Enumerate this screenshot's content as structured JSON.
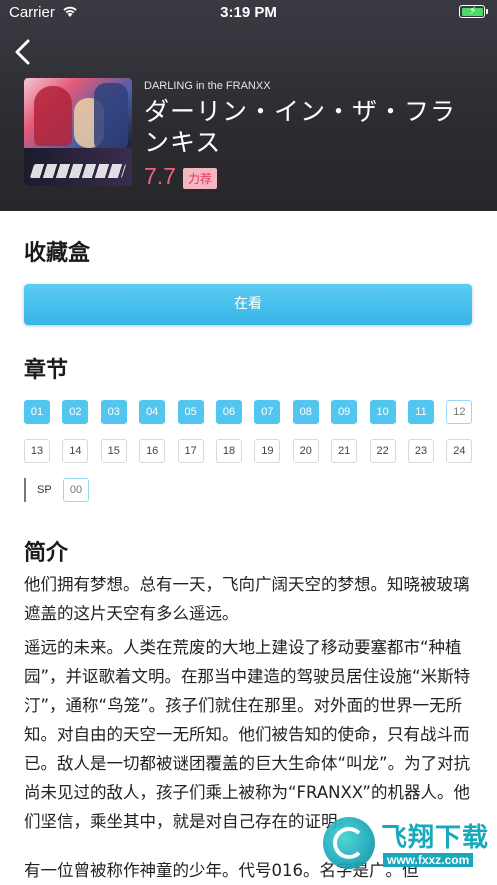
{
  "status_bar": {
    "carrier": "Carrier",
    "time": "3:19 PM"
  },
  "anime": {
    "subtitle": "DARLING in the FRANXX",
    "title": "ダーリン・イン・ザ・フランキス",
    "score": "7.7",
    "tag": "力荐"
  },
  "favorites": {
    "heading": "收藏盒",
    "button_label": "在看"
  },
  "chapters": {
    "heading": "章节",
    "episodes": [
      "01",
      "02",
      "03",
      "04",
      "05",
      "06",
      "07",
      "08",
      "09",
      "10",
      "11",
      "12",
      "13",
      "14",
      "15",
      "16",
      "17",
      "18",
      "19",
      "20",
      "21",
      "22",
      "23",
      "24"
    ],
    "watched_count": 11,
    "current_episode": "12",
    "sp_label": "SP",
    "sp_episodes": [
      "00"
    ]
  },
  "intro": {
    "heading": "简介",
    "paragraphs": [
      "他们拥有梦想。总有一天，飞向广阔天空的梦想。知晓被玻璃遮盖的这片天空有多么遥远。",
      "遥远的未来。人类在荒废的大地上建设了移动要塞都市“种植园”，并讴歌着文明。在那当中建造的驾驶员居住设施“米斯特汀”，通称“鸟笼”。孩子们就住在那里。对外面的世界一无所知。对自由的天空一无所知。他们被告知的使命，只有战斗而已。敌人是一切都被谜团覆盖的巨大生命体“叫龙”。为了对抗尚未见过的敌人，孩子们乘上被称为“FRANXX”的机器人。他们坚信，乘坐其中，就是对自己存在的证明。",
      "有一位曾被称作神童的少年。代号016。名字是广。但"
    ]
  },
  "watermark": {
    "text": "飞翔下载",
    "url": "www.fxxz.com"
  },
  "colors": {
    "accent": "#53c6f0",
    "score": "#f0607a",
    "header_bg": "#2b2b31"
  }
}
